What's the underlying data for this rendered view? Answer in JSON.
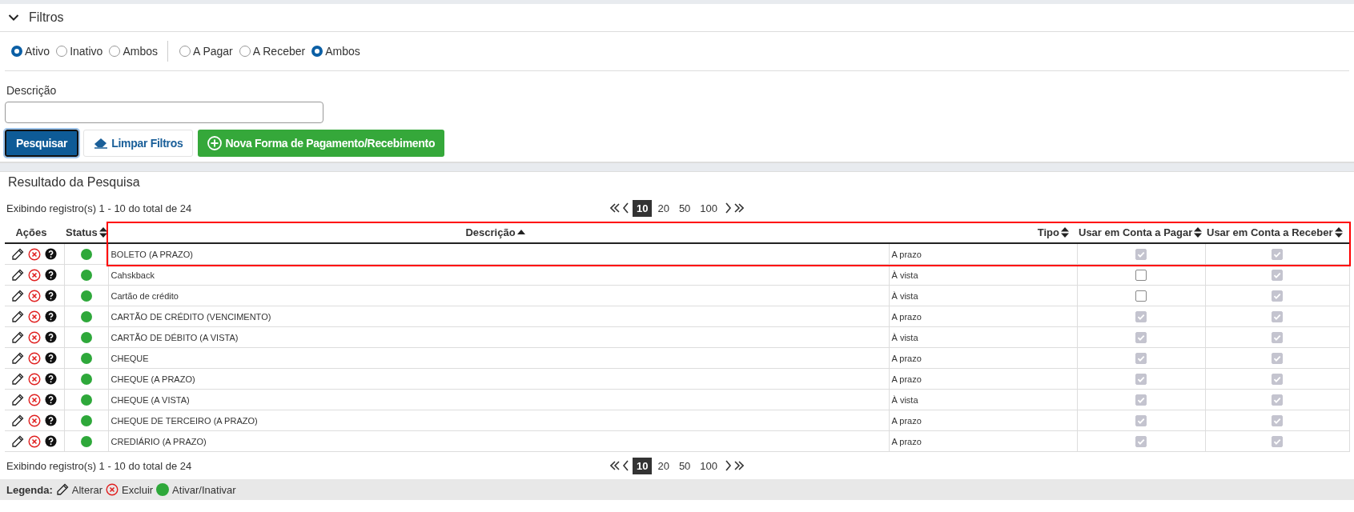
{
  "filters": {
    "title": "Filtros",
    "expanded": true,
    "status_options": [
      {
        "label": "Ativo",
        "selected": true
      },
      {
        "label": "Inativo",
        "selected": false
      },
      {
        "label": "Ambos",
        "selected": false
      }
    ],
    "type_options": [
      {
        "label": "A Pagar",
        "selected": false
      },
      {
        "label": "A Receber",
        "selected": false
      },
      {
        "label": "Ambos",
        "selected": true
      }
    ],
    "description_label": "Descrição",
    "buttons": [
      {
        "kind": "search",
        "label": "Pesquisar"
      },
      {
        "kind": "clear",
        "label": "Limpar Filtros"
      },
      {
        "kind": "new",
        "label": "Nova Forma de Pagamento/Recebimento"
      }
    ]
  },
  "results": {
    "title": "Resultado da Pesquisa",
    "summary_top": "Exibindo registro(s) 1 - 10 do total de 24",
    "summary_bottom": "Exibindo registro(s) 1 - 10 do total de 24",
    "page_sizes_top": [
      {
        "label": "10",
        "selected": true
      },
      {
        "label": "20",
        "selected": false
      },
      {
        "label": "50",
        "selected": false
      },
      {
        "label": "100",
        "selected": false
      }
    ],
    "page_sizes_bottom": [
      {
        "label": "10",
        "selected": true
      },
      {
        "label": "20",
        "selected": false
      },
      {
        "label": "50",
        "selected": false
      },
      {
        "label": "100",
        "selected": false
      }
    ],
    "table": {
      "highlight_first_row": true,
      "columns": [
        {
          "kind": "actions",
          "label": "Ações",
          "sorted": false
        },
        {
          "kind": "data",
          "label": "Status",
          "sorted": false
        },
        {
          "kind": "data",
          "label": "Descrição",
          "sorted": true
        },
        {
          "kind": "data",
          "label": "Tipo",
          "sorted": false
        },
        {
          "kind": "data",
          "label": "Usar em Conta a Pagar",
          "sorted": false
        },
        {
          "kind": "data",
          "label": "Usar em Conta a Receber",
          "sorted": false
        }
      ],
      "rows": [
        {
          "description": "BOLETO (A PRAZO)",
          "tipo": "A prazo",
          "active": true,
          "pagar": true,
          "receber": true
        },
        {
          "description": "Cahskback",
          "tipo": "À vista",
          "active": true,
          "pagar": false,
          "receber": true
        },
        {
          "description": "Cartão de crédito",
          "tipo": "À vista",
          "active": true,
          "pagar": false,
          "receber": true
        },
        {
          "description": "CARTÃO DE CRÉDITO (VENCIMENTO)",
          "tipo": "A prazo",
          "active": true,
          "pagar": true,
          "receber": true
        },
        {
          "description": "CARTÃO DE DÉBITO (A VISTA)",
          "tipo": "À vista",
          "active": true,
          "pagar": true,
          "receber": true
        },
        {
          "description": "CHEQUE",
          "tipo": "A prazo",
          "active": true,
          "pagar": true,
          "receber": true
        },
        {
          "description": "CHEQUE (A PRAZO)",
          "tipo": "A prazo",
          "active": true,
          "pagar": true,
          "receber": true
        },
        {
          "description": "CHEQUE (A VISTA)",
          "tipo": "À vista",
          "active": true,
          "pagar": true,
          "receber": true
        },
        {
          "description": "CHEQUE DE TERCEIRO (A PRAZO)",
          "tipo": "A prazo",
          "active": true,
          "pagar": true,
          "receber": true
        },
        {
          "description": "CREDIÁRIO (A PRAZO)",
          "tipo": "A prazo",
          "active": true,
          "pagar": true,
          "receber": true
        }
      ]
    }
  },
  "legend": {
    "title": "Legenda:",
    "items": [
      {
        "kind": "edit",
        "label": "Alterar"
      },
      {
        "kind": "delete",
        "label": "Excluir"
      },
      {
        "kind": "status",
        "label": "Ativar/Inativar"
      }
    ]
  }
}
